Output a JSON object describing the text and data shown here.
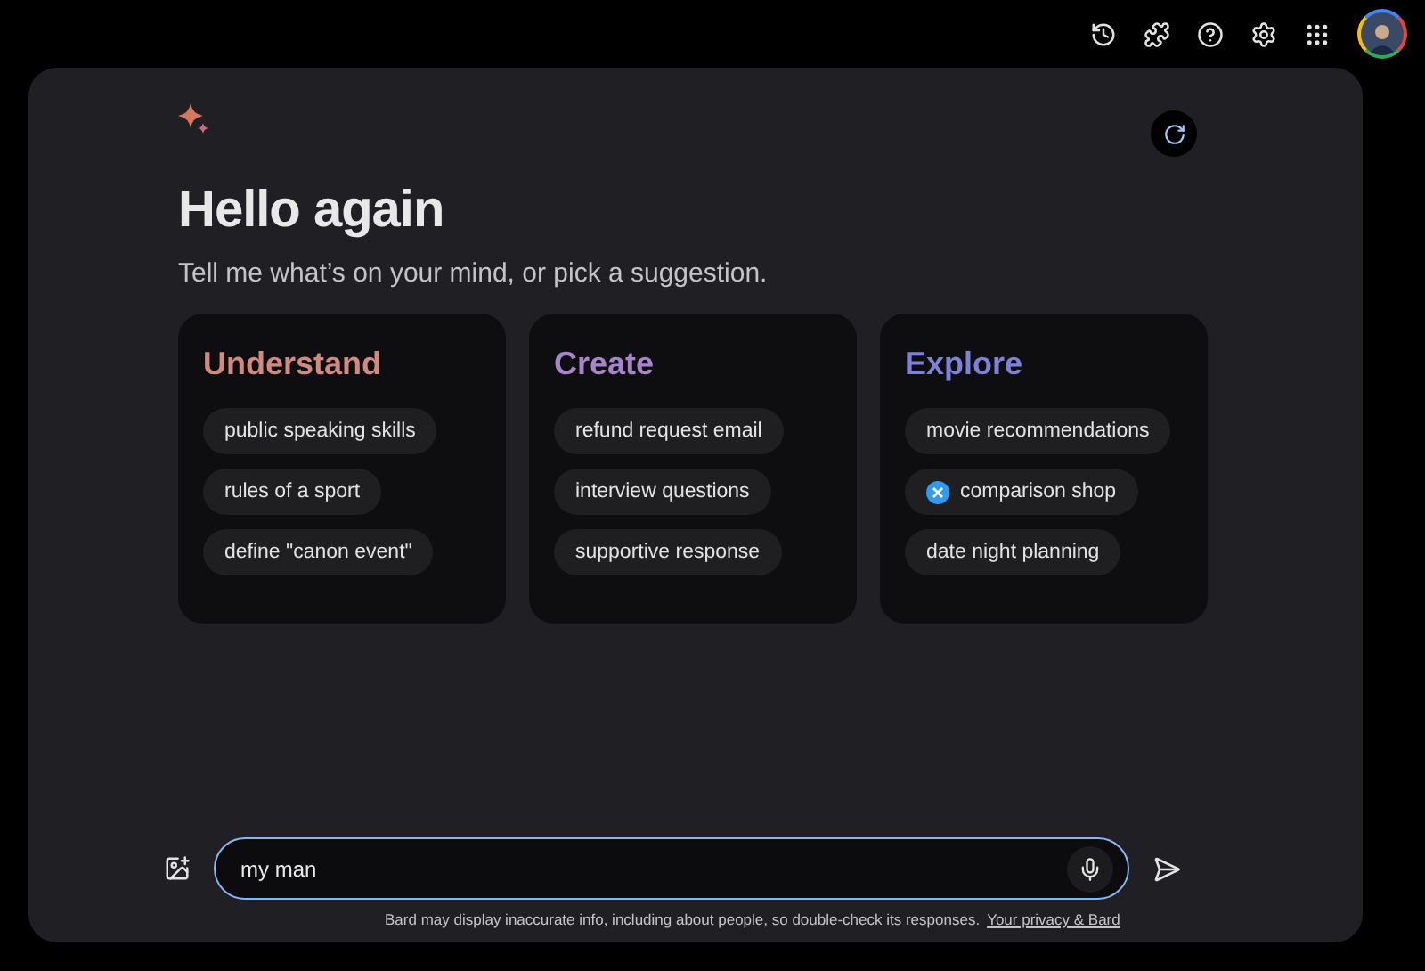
{
  "greeting": {
    "title": "Hello again",
    "subtitle": "Tell me what’s on your mind, or pick a suggestion."
  },
  "cards": [
    {
      "title": "Understand",
      "color": "#d08a80",
      "suggestions": [
        {
          "label": "public speaking skills",
          "kind": "plain"
        },
        {
          "label": "rules of a sport",
          "kind": "plain"
        },
        {
          "label": "define \"canon event\"",
          "kind": "plain"
        }
      ]
    },
    {
      "title": "Create",
      "color": "#a884cc",
      "suggestions": [
        {
          "label": "refund request email",
          "kind": "plain"
        },
        {
          "label": "interview questions",
          "kind": "plain"
        },
        {
          "label": "supportive response",
          "kind": "plain"
        }
      ]
    },
    {
      "title": "Explore",
      "color": "#7d82d8",
      "suggestions": [
        {
          "label": "movie recommendations",
          "kind": "plain"
        },
        {
          "label": "comparison shop",
          "kind": "extension"
        },
        {
          "label": "date night planning",
          "kind": "plain"
        }
      ]
    }
  ],
  "prompt": {
    "value": "my man"
  },
  "footer": {
    "notice": "Bard may display inaccurate info, including about people, so double-check its responses.",
    "link": "Your privacy & Bard"
  }
}
